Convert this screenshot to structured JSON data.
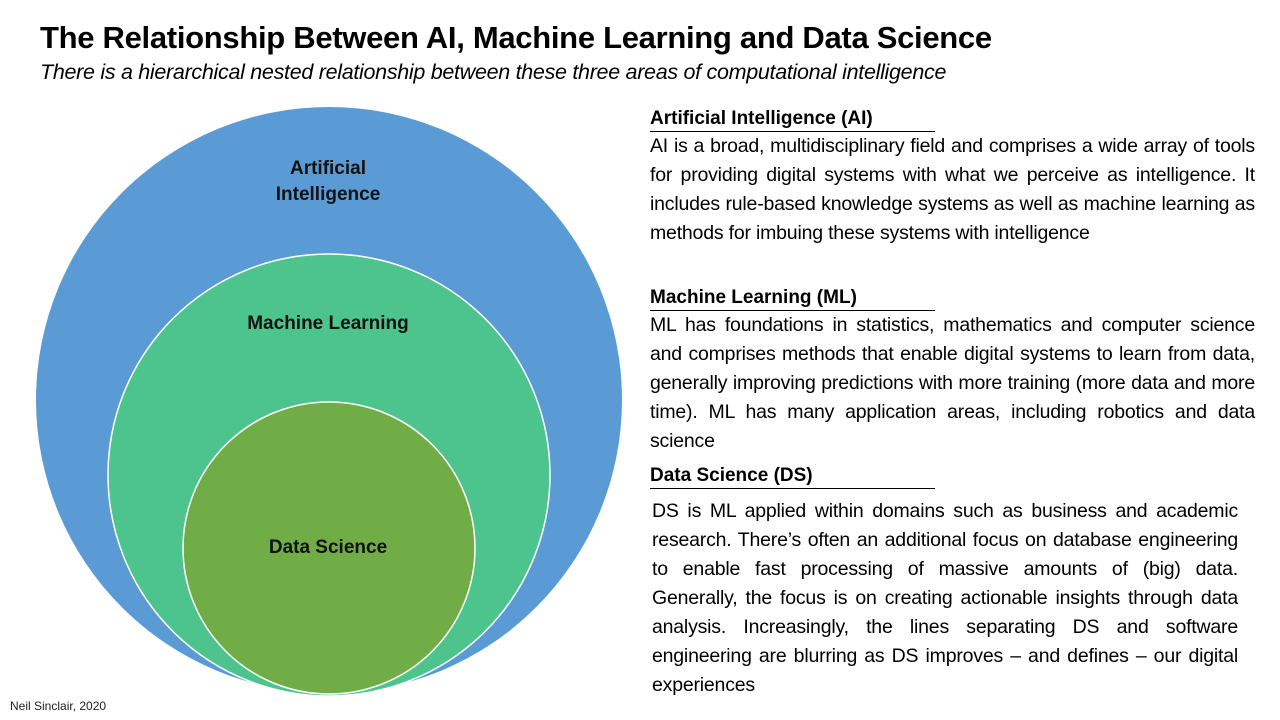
{
  "header": {
    "title": "The Relationship Between AI, Machine Learning and Data Science",
    "subtitle": "There is a hierarchical nested relationship between these three areas of computational intelligence"
  },
  "diagram": {
    "type": "nested-circles",
    "circles": [
      {
        "id": "ai",
        "label_lines": [
          "Artificial",
          "Intelligence"
        ],
        "color": "#5B9BD5"
      },
      {
        "id": "ml",
        "label_lines": [
          "Machine Learning"
        ],
        "color": "#4DC48E"
      },
      {
        "id": "ds",
        "label_lines": [
          "Data Science"
        ],
        "color": "#70AD47"
      }
    ],
    "outline_color": "#FFFFFF"
  },
  "sections": [
    {
      "heading": "Artificial Intelligence (AI)",
      "body": "AI is a broad, multidisciplinary field and comprises a wide array of tools for providing digital systems with what we perceive as intelligence. It includes rule-based knowledge systems as well as machine learning as methods for imbuing these systems with intelligence"
    },
    {
      "heading": "Machine Learning (ML)",
      "body": "ML has foundations in statistics, mathematics and computer science and comprises methods that enable digital systems to learn from data, generally improving predictions with more training (more data and more time). ML has many application areas, including robotics and data science"
    },
    {
      "heading": "Data Science (DS)",
      "body": "DS is ML applied within domains such as business and academic research. There’s often an additional focus on database engineering to enable fast processing of massive amounts of (big) data. Generally, the focus is on creating actionable insights through data analysis. Increasingly, the lines separating DS and software engineering are blurring as DS improves – and defines – our digital experiences"
    }
  ],
  "footer": {
    "credit": "Neil Sinclair, 2020"
  }
}
